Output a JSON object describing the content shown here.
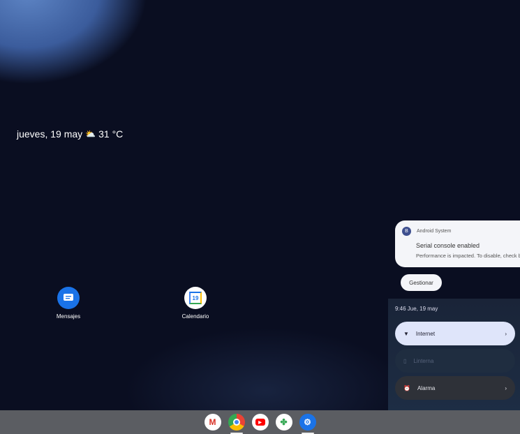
{
  "home": {
    "date": "jueves, 19 may",
    "weather_icon": "partly-cloudy-icon",
    "temperature": "31 °C"
  },
  "apps": [
    {
      "label": "Mensajes",
      "icon": "messages-icon",
      "color": "#1a73e8"
    },
    {
      "label": "Calendario",
      "icon": "calendar-icon",
      "day": "19"
    }
  ],
  "notification": {
    "app": "Android System",
    "app_badge": "B",
    "title": "Serial console enabled",
    "body": "Performance is impacted. To disable, check bootloader.",
    "manage_label": "Gestionar"
  },
  "quick_settings": {
    "time": "9:46 Jue, 19 may",
    "tiles": [
      {
        "label": "Internet",
        "icon": "wifi-icon",
        "active": true
      },
      {
        "label": "Linterna",
        "icon": "flashlight-icon",
        "active": false,
        "disabled": true
      },
      {
        "label": "Alarma",
        "icon": "alarm-icon",
        "active": false
      }
    ]
  },
  "dock": [
    {
      "name": "Gmail",
      "running": false
    },
    {
      "name": "Chrome",
      "running": true
    },
    {
      "name": "YouTube",
      "running": false
    },
    {
      "name": "Photos",
      "running": false
    },
    {
      "name": "Settings",
      "running": true
    }
  ]
}
